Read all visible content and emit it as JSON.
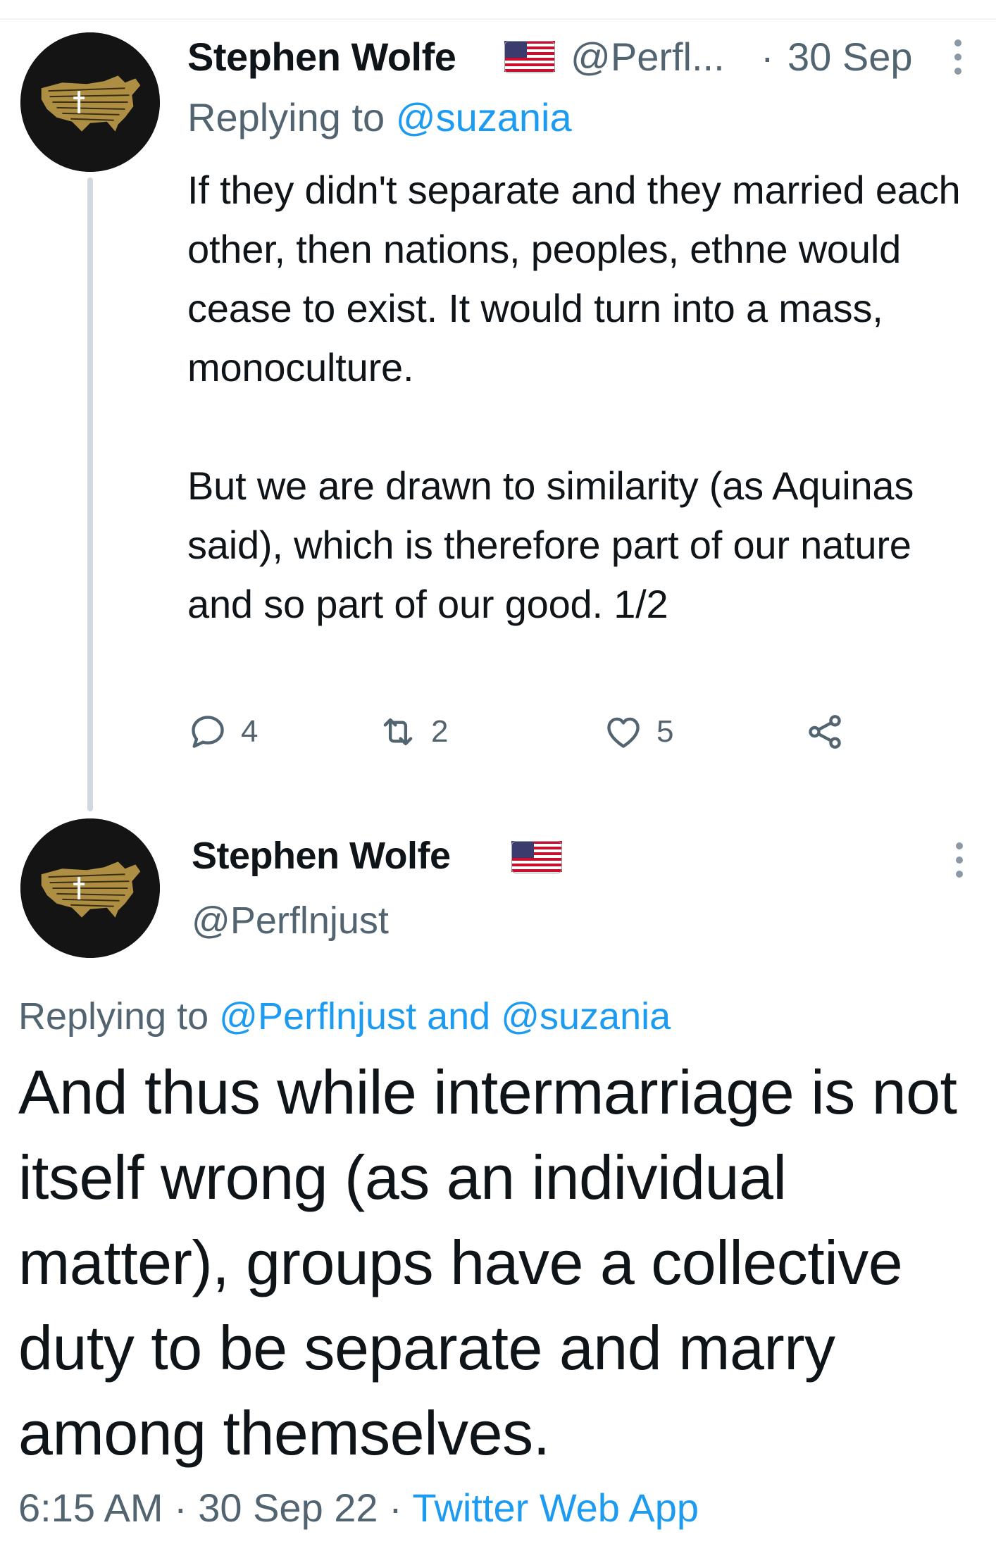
{
  "colors": {
    "text": "#0f1419",
    "muted": "#536471",
    "link": "#1d9bf0",
    "thread_line": "#cfd9de",
    "avatar_bg": "#141414",
    "avatar_map": "#c9a34a"
  },
  "tweet1": {
    "author_name": "Stephen Wolfe",
    "flag_icon": "us-flag-icon",
    "handle_truncated": "@Perfl...",
    "separator": "·",
    "date": "30 Sep",
    "replying_prefix": "Replying to ",
    "replying_user": "@suzania",
    "text": "If they didn't separate and they married each other, then  nations, peoples, ethne would cease to exist. It would turn into a mass, monoculture.\n\nBut we are drawn to similarity (as Aquinas said), which is therefore part of our nature and so part of our good. 1/2",
    "replies": "4",
    "retweets": "2",
    "likes": "5"
  },
  "tweet2": {
    "author_name": "Stephen Wolfe",
    "handle": "@Perflnjust",
    "replying_prefix": "Replying to ",
    "replying_users": "@Perflnjust and @suzania",
    "text": "And thus while intermarriage is not itself wrong (as an individual matter), groups have a collective duty to be separate and marry among themselves.",
    "time": "6:15 AM",
    "sep1": " · ",
    "date": "30 Sep 22",
    "sep2": " · ",
    "source": "Twitter Web App"
  }
}
